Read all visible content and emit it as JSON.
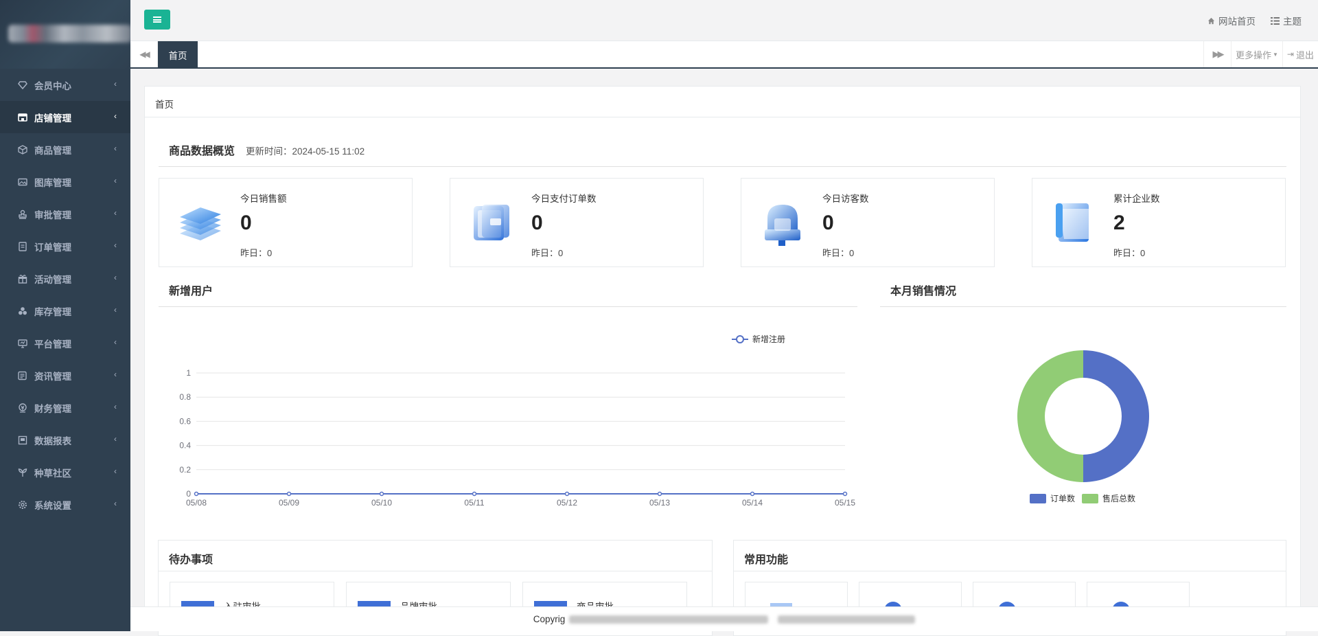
{
  "sidebar": {
    "items": [
      {
        "label": "会员中心",
        "icon": "diamond-icon"
      },
      {
        "label": "店铺管理",
        "icon": "store-icon",
        "active": true
      },
      {
        "label": "商品管理",
        "icon": "cube-icon"
      },
      {
        "label": "图库管理",
        "icon": "image-icon"
      },
      {
        "label": "审批管理",
        "icon": "stamp-icon"
      },
      {
        "label": "订单管理",
        "icon": "order-icon"
      },
      {
        "label": "活动管理",
        "icon": "gift-icon"
      },
      {
        "label": "库存管理",
        "icon": "cubes-icon"
      },
      {
        "label": "平台管理",
        "icon": "monitor-icon"
      },
      {
        "label": "资讯管理",
        "icon": "news-icon"
      },
      {
        "label": "财务管理",
        "icon": "finance-icon"
      },
      {
        "label": "数据报表",
        "icon": "report-icon"
      },
      {
        "label": "种草社区",
        "icon": "sprout-icon"
      },
      {
        "label": "系统设置",
        "icon": "gear-icon"
      }
    ]
  },
  "topbar": {
    "site_home": "网站首页",
    "theme": "主题"
  },
  "tabs": {
    "home": "首页",
    "more_ops": "更多操作",
    "logout": "退出"
  },
  "breadcrumb": "首页",
  "overview": {
    "title": "商品数据概览",
    "update_time": "更新时间：2024-05-15 11:02",
    "cards": [
      {
        "label": "今日销售额",
        "value": "0",
        "yesterday": "昨日：0"
      },
      {
        "label": "今日支付订单数",
        "value": "0",
        "yesterday": "昨日：0"
      },
      {
        "label": "今日访客数",
        "value": "0",
        "yesterday": "昨日：0"
      },
      {
        "label": "累计企业数",
        "value": "2",
        "yesterday": "昨日：0"
      }
    ]
  },
  "new_users": {
    "title": "新增用户"
  },
  "monthly_sales": {
    "title": "本月销售情况"
  },
  "chart_data": [
    {
      "type": "line",
      "title": "新增用户",
      "x": [
        "05/08",
        "05/09",
        "05/10",
        "05/11",
        "05/12",
        "05/13",
        "05/14",
        "05/15"
      ],
      "series": [
        {
          "name": "新增注册",
          "values": [
            0,
            0,
            0,
            0,
            0,
            0,
            0,
            0
          ]
        }
      ],
      "yticks": [
        "0",
        "0.2",
        "0.4",
        "0.6",
        "0.8",
        "1"
      ],
      "ylim": [
        0,
        1
      ],
      "grid": true,
      "legend": "top-right",
      "color": "#5470c6"
    },
    {
      "type": "pie",
      "title": "本月销售情况",
      "donut": true,
      "categories": [
        "订单数",
        "售后总数"
      ],
      "values": [
        50,
        50
      ],
      "colors": [
        "#5470c6",
        "#91cc75"
      ],
      "legend": "bottom"
    }
  ],
  "todo": {
    "title": "待办事项",
    "items": [
      "入驻审批",
      "品牌审批",
      "商品审批"
    ]
  },
  "common": {
    "title": "常用功能"
  },
  "footer": {
    "copyright": "Copyrig"
  },
  "colors": {
    "sidebar_bg": "#2f4050",
    "accent": "#1ab394",
    "series_blue": "#5470c6",
    "series_green": "#91cc75"
  }
}
